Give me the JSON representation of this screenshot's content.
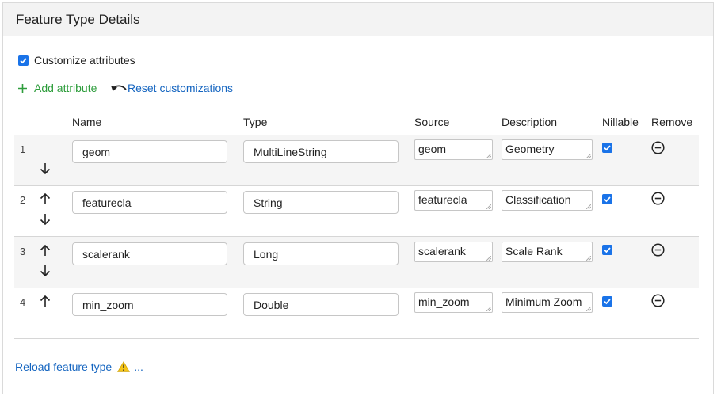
{
  "panel": {
    "title": "Feature Type Details"
  },
  "customize": {
    "label": "Customize attributes",
    "checked": true
  },
  "actions": {
    "add_label": "Add attribute",
    "reset_label": "Reset customizations"
  },
  "table": {
    "headers": {
      "name": "Name",
      "type": "Type",
      "source": "Source",
      "description": "Description",
      "nillable": "Nillable",
      "remove": "Remove"
    },
    "rows": [
      {
        "index": "1",
        "name": "geom",
        "type": "MultiLineString",
        "source": "geom",
        "description": "Geometry",
        "nillable": true,
        "up": false,
        "down": true
      },
      {
        "index": "2",
        "name": "featurecla",
        "type": "String",
        "source": "featurecla",
        "description": "Classification",
        "nillable": true,
        "up": true,
        "down": true
      },
      {
        "index": "3",
        "name": "scalerank",
        "type": "Long",
        "source": "scalerank",
        "description": "Scale Rank",
        "nillable": true,
        "up": true,
        "down": true
      },
      {
        "index": "4",
        "name": "min_zoom",
        "type": "Double",
        "source": "min_zoom",
        "description": "Minimum Zoom",
        "nillable": true,
        "up": true,
        "down": false
      }
    ]
  },
  "footer": {
    "reload_label": "Reload feature type",
    "ellipsis": "..."
  },
  "icons": {
    "add": "plus-icon",
    "reset": "undo-icon",
    "up": "arrow-up-icon",
    "down": "arrow-down-icon",
    "remove": "remove-circle-icon",
    "warning": "warning-icon"
  },
  "colors": {
    "accent_blue": "#1a73e8",
    "link_blue": "#1565c0",
    "add_green": "#2e9d3c",
    "warning": "#f5c518"
  }
}
